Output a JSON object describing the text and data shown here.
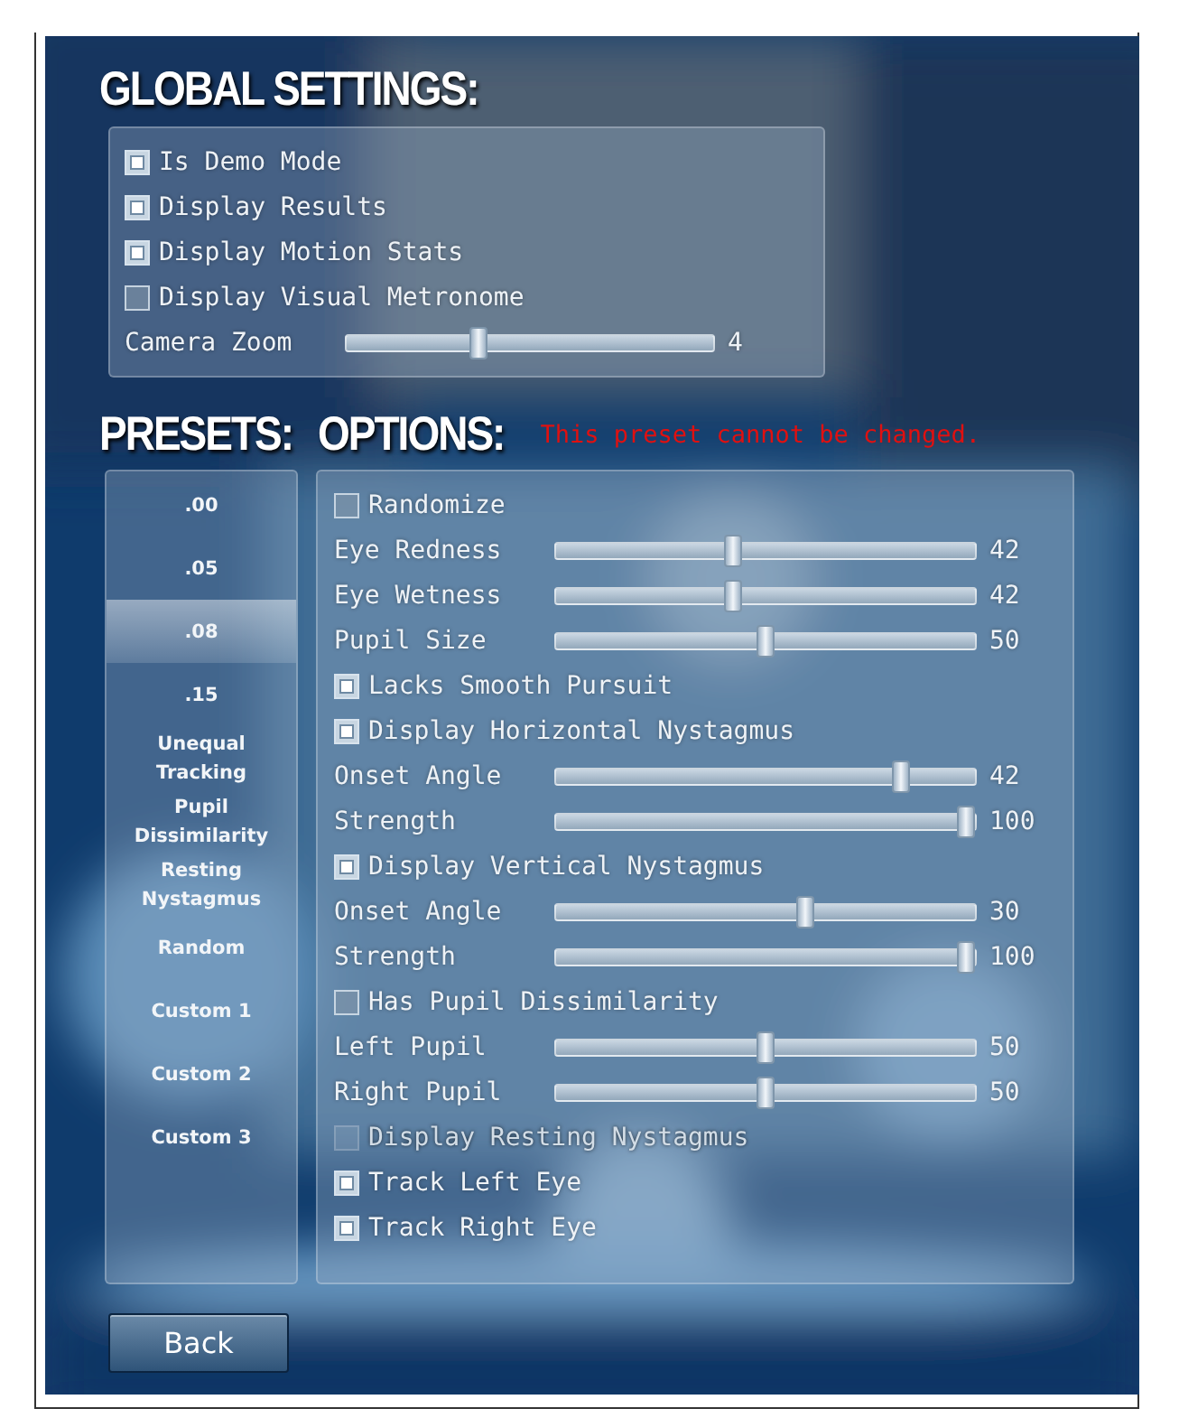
{
  "global_settings": {
    "title": "GLOBAL SETTINGS:",
    "items": [
      {
        "kind": "checkbox",
        "label": "Is Demo Mode",
        "checked": true
      },
      {
        "kind": "checkbox",
        "label": "Display Results",
        "checked": true
      },
      {
        "kind": "checkbox",
        "label": "Display Motion Stats",
        "checked": true
      },
      {
        "kind": "checkbox",
        "label": "Display Visual Metronome",
        "checked": false
      },
      {
        "kind": "slider",
        "label": "Camera Zoom",
        "level": 0.35,
        "reading": "4"
      }
    ]
  },
  "presets": {
    "title": "PRESETS:",
    "items": [
      {
        "label": ".00",
        "selected": false
      },
      {
        "label": ".05",
        "selected": false
      },
      {
        "label": ".08",
        "selected": true
      },
      {
        "label": ".15",
        "selected": false
      },
      {
        "label": "Unequal Tracking",
        "selected": false
      },
      {
        "label": "Pupil Dissimilarity",
        "selected": false
      },
      {
        "label": "Resting Nystagmus",
        "selected": false
      },
      {
        "label": "Random",
        "selected": false
      },
      {
        "label": "Custom 1",
        "selected": false
      },
      {
        "label": "Custom 2",
        "selected": false
      },
      {
        "label": "Custom 3",
        "selected": false
      }
    ]
  },
  "options": {
    "title": "OPTIONS:",
    "warning": "This preset cannot be changed.",
    "items": [
      {
        "kind": "checkbox",
        "label": "Randomize",
        "checked": false,
        "disabled": false
      },
      {
        "kind": "slider",
        "label": "Eye Redness",
        "level": 0.42,
        "reading": "42"
      },
      {
        "kind": "slider",
        "label": "Eye Wetness",
        "level": 0.42,
        "reading": "42"
      },
      {
        "kind": "slider",
        "label": "Pupil Size",
        "level": 0.5,
        "reading": "50"
      },
      {
        "kind": "checkbox",
        "label": "Lacks Smooth Pursuit",
        "checked": true,
        "disabled": false
      },
      {
        "kind": "checkbox",
        "label": "Display Horizontal Nystagmus",
        "checked": true,
        "disabled": false
      },
      {
        "kind": "slider",
        "label": "Onset Angle",
        "level": 0.84,
        "reading": "42"
      },
      {
        "kind": "slider",
        "label": "Strength",
        "level": 1,
        "reading": "100"
      },
      {
        "kind": "checkbox",
        "label": "Display Vertical Nystagmus",
        "checked": true,
        "disabled": false
      },
      {
        "kind": "slider",
        "label": "Onset Angle",
        "level": 0.6,
        "reading": "30"
      },
      {
        "kind": "slider",
        "label": "Strength",
        "level": 1,
        "reading": "100"
      },
      {
        "kind": "checkbox",
        "label": "Has Pupil Dissimilarity",
        "checked": false,
        "disabled": false
      },
      {
        "kind": "slider",
        "label": "Left Pupil",
        "level": 0.5,
        "reading": "50"
      },
      {
        "kind": "slider",
        "label": "Right Pupil",
        "level": 0.5,
        "reading": "50"
      },
      {
        "kind": "checkbox",
        "label": "Display Resting Nystagmus",
        "checked": false,
        "disabled": true
      },
      {
        "kind": "checkbox",
        "label": "Track Left Eye",
        "checked": true,
        "disabled": false
      },
      {
        "kind": "checkbox",
        "label": "Track Right Eye",
        "checked": true,
        "disabled": false
      }
    ]
  },
  "back_button": "Back"
}
